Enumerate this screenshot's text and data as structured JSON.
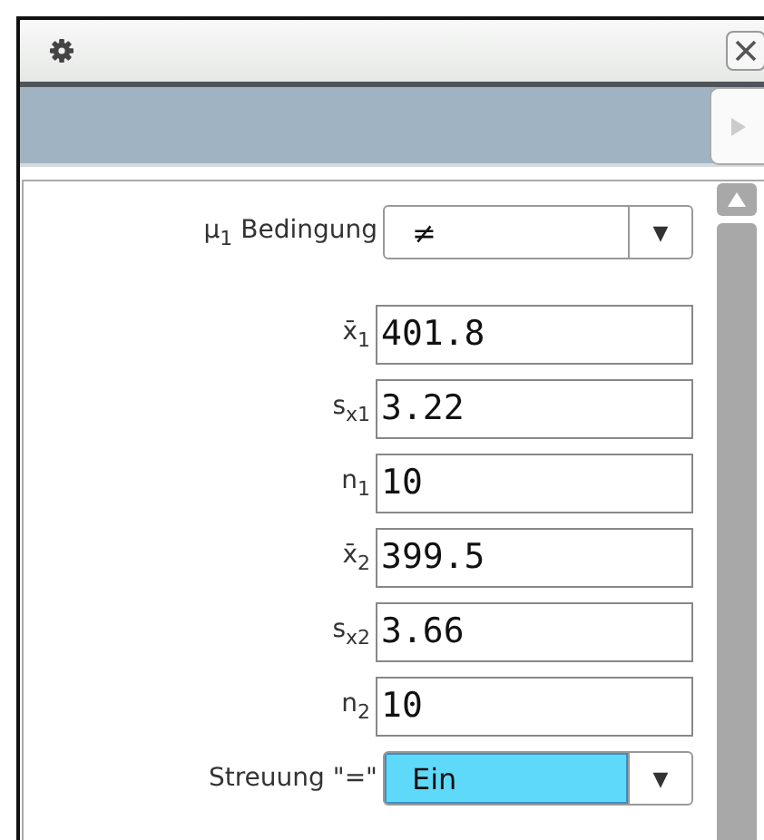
{
  "panel": {
    "rows": [
      {
        "kind": "dropdown",
        "label": "μ$_{1}$ Bedingung",
        "value": "≠",
        "caret": "▼",
        "selected": false
      },
      {
        "kind": "field",
        "label": "x̄$_{1}$",
        "value": "401.8"
      },
      {
        "kind": "field",
        "label": "s$_{x1}$",
        "value": "3.22"
      },
      {
        "kind": "field",
        "label": "n$_{1}$",
        "value": "10"
      },
      {
        "kind": "field",
        "label": "x̄$_{2}$",
        "value": "399.5"
      },
      {
        "kind": "field",
        "label": "s$_{x2}$",
        "value": "3.66"
      },
      {
        "kind": "field",
        "label": "n$_{2}$",
        "value": "10"
      },
      {
        "kind": "dropdown",
        "label": "Streuung \"=\"",
        "value": "Ein",
        "caret": "▼",
        "selected": true
      }
    ]
  }
}
